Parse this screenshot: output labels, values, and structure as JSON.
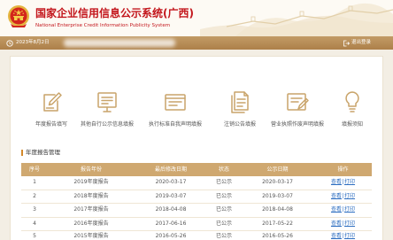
{
  "header": {
    "title": "国家企业信用信息公示系统(广西)",
    "subtitle": "National Enterprise Credit Information Publicity System",
    "icon": "national-emblem-icon"
  },
  "user_bar": {
    "date": "2023年8月2日",
    "logout_label": "退出登录",
    "icons": [
      "clock-icon",
      "logout-icon"
    ]
  },
  "menu": {
    "items": [
      {
        "label": "年度报告填写",
        "icon": "edit-report-icon"
      },
      {
        "label": "其他自行公示信息填报",
        "icon": "form-screen-icon"
      },
      {
        "label": "执行标准自我声明填报",
        "icon": "standard-document-icon"
      },
      {
        "label": "注销公告填报",
        "icon": "notice-document-icon"
      },
      {
        "label": "营业执照作废声明填报",
        "icon": "certificate-edit-icon"
      },
      {
        "label": "填报须知",
        "icon": "lightbulb-icon"
      }
    ]
  },
  "annual_reports": {
    "title": "年度报告管理",
    "columns": [
      "序号",
      "报告年份",
      "最后修改日期",
      "状态",
      "公示日期",
      "操作"
    ],
    "action_separator": "|",
    "rows": [
      {
        "no": "1",
        "report": "2019年度报告",
        "modified": "2020-03-17",
        "status": "已公示",
        "published": "2020-03-17",
        "actions": [
          "查看",
          "打印"
        ]
      },
      {
        "no": "2",
        "report": "2018年度报告",
        "modified": "2019-03-07",
        "status": "已公示",
        "published": "2019-03-07",
        "actions": [
          "查看",
          "打印"
        ]
      },
      {
        "no": "3",
        "report": "2017年度报告",
        "modified": "2018-04-08",
        "status": "已公示",
        "published": "2018-04-08",
        "actions": [
          "查看",
          "打印"
        ]
      },
      {
        "no": "4",
        "report": "2016年度报告",
        "modified": "2017-06-16",
        "status": "已公示",
        "published": "2017-05-22",
        "actions": [
          "查看",
          "打印"
        ]
      },
      {
        "no": "5",
        "report": "2015年度报告",
        "modified": "2016-05-26",
        "status": "已公示",
        "published": "2016-05-26",
        "actions": [
          "查看",
          "打印"
        ]
      }
    ]
  },
  "colors": {
    "brand_red": "#c3161c",
    "icon_tan": "#c9a46a",
    "link_blue": "#2f6fc1",
    "table_header": "#cfa870",
    "section_marker": "#d4892a"
  }
}
